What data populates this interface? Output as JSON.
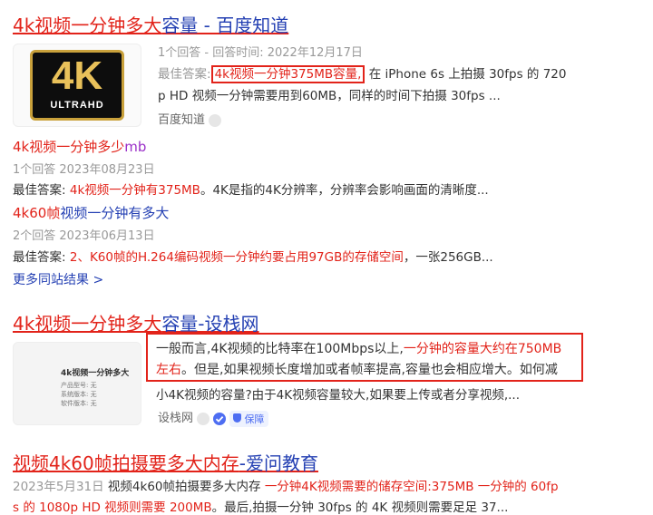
{
  "r1": {
    "title_red": "4k视频一分钟多大",
    "title_rest": "容量 - 百度知道",
    "meta": "1个回答 - 回答时间: 2022年12月17日",
    "best_label": "最佳答案:",
    "best_highlight": "4k视频一分钟375MB容量,",
    "line1_rest": "在 iPhone 6s 上拍摄 30fps 的 720",
    "line2": "p HD 视频一分钟需要用到60MB，同样的时间下拍摄 30fps ...",
    "source": "百度知道",
    "logo_big": "4K",
    "logo_small": "ULTRAHD",
    "sub1": {
      "title_red": "4k视频一分钟多少",
      "title_purple": "mb",
      "meta": "1个回答   2023年08月23日",
      "best_label": "最佳答案:",
      "best_red": "4k视频一分钟有375MB",
      "best_rest": "。4K是指的4K分辨率，分辨率会影响画面的清晰度..."
    },
    "sub2": {
      "title_a": "4k60帧",
      "title_b": "视频一分钟有多大",
      "meta": "2个回答   2023年06月13日",
      "best_label": "最佳答案:",
      "best_red": "2、K60帧的H.264编码视频一分钟约要占用97GB的存储空间",
      "best_rest": "，一张256GB..."
    },
    "more": "更多同站结果 >"
  },
  "r2": {
    "title_red": "4k视频一分钟多大",
    "title_rest": "容量-设栈网",
    "text_l1_a": "一般而言,4K视频的比特率在100Mbps以上,",
    "text_l1_b": "一分钟的容量大约在750MB",
    "text_l2_a": "左右",
    "text_l2_b": "。但是,如果视频长度增加或者帧率提高,容量也会相应增大。如何减",
    "text_l3": "小4K视频的容量?由于4K视频容量较大,如果要上传或者分享视频,...",
    "source": "设栈网",
    "badge": "保障",
    "thumb_title": "4k视频一分钟多大",
    "thumb_l1": "产品型号: 无",
    "thumb_l2": "系统版本: 无",
    "thumb_l3": "软件版本: 无"
  },
  "r3": {
    "title_a": "视频4k60帧拍摄要",
    "title_b": "多大内存",
    "title_c": "-爱问教育",
    "date": "2023年5月31日",
    "text_a": "视频4k60帧拍摄要多大内存",
    "text_b": "一分钟4K视频需要的储存空间:375MB 一分钟的 60fp",
    "text_l2_red": "s 的 1080p HD 视频则需要 200MB",
    "text_l2_rest": "。最后,拍摄一分钟 30fps 的 4K 视频则需要足足 37..."
  }
}
